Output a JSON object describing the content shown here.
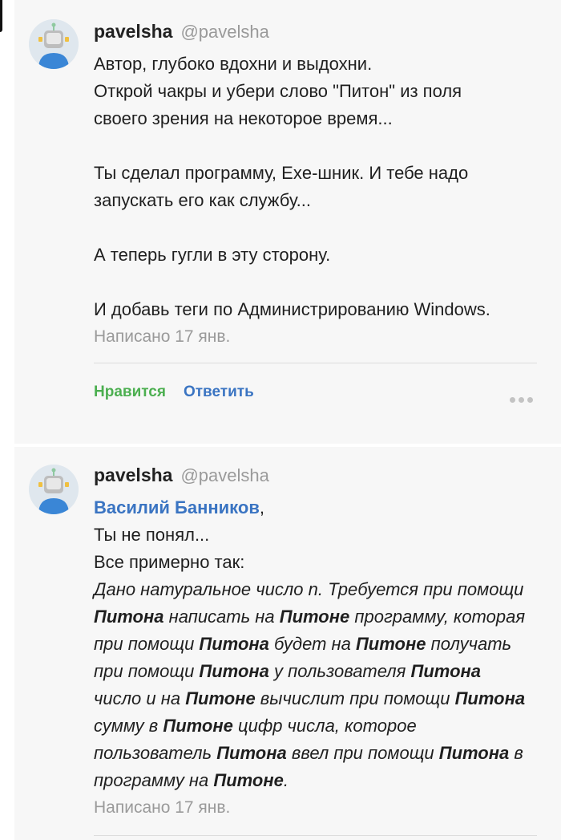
{
  "comments": [
    {
      "author": "pavelsha",
      "handle": "@pavelsha",
      "paragraphs": [
        "Автор, глубоко вдохни и выдохни.",
        "Открой чакры и убери слово \"Питон\" из поля",
        "своего зрения на некоторое время...",
        "Ты сделал программу, Exe-шник. И тебе надо",
        "запускать его как службу...",
        "А теперь гугли в эту сторону.",
        "И добавь теги по Администрированию Windows."
      ],
      "timestamp": "Написано 17 янв.",
      "actions": {
        "like": "Нравится",
        "reply": "Ответить"
      }
    },
    {
      "author": "pavelsha",
      "handle": "@pavelsha",
      "mention": "Василий Банников",
      "mention_suffix": ",",
      "lines": [
        "Ты не понял...",
        "Все примерно так:"
      ],
      "quote": [
        [
          "Дано натуральное число n. Требуется при помощи"
        ],
        [
          "Питона",
          " написать на ",
          "Питоне",
          " программу, которая"
        ],
        [
          "при помощи ",
          "Питона",
          " будет на ",
          "Питоне",
          " получать"
        ],
        [
          "при помощи ",
          "Питона",
          " у пользователя ",
          "Питона"
        ],
        [
          "число и на ",
          "Питоне",
          " вычислит при помощи ",
          "Питона"
        ],
        [
          "сумму в ",
          "Питоне",
          " цифр числа, которое"
        ],
        [
          "пользователь ",
          "Питона",
          " ввел при помощи ",
          "Питона",
          " в"
        ],
        [
          "программу на ",
          "Питоне",
          "."
        ]
      ],
      "timestamp": "Написано 17 янв."
    }
  ],
  "colors": {
    "accent_link": "#3a74c2",
    "like_green": "#4caf50",
    "muted": "#9a9a9a",
    "card_bg": "#f7f7f7"
  },
  "icons": {
    "avatar": "robot-avatar-icon",
    "more": "more-dots-icon"
  }
}
